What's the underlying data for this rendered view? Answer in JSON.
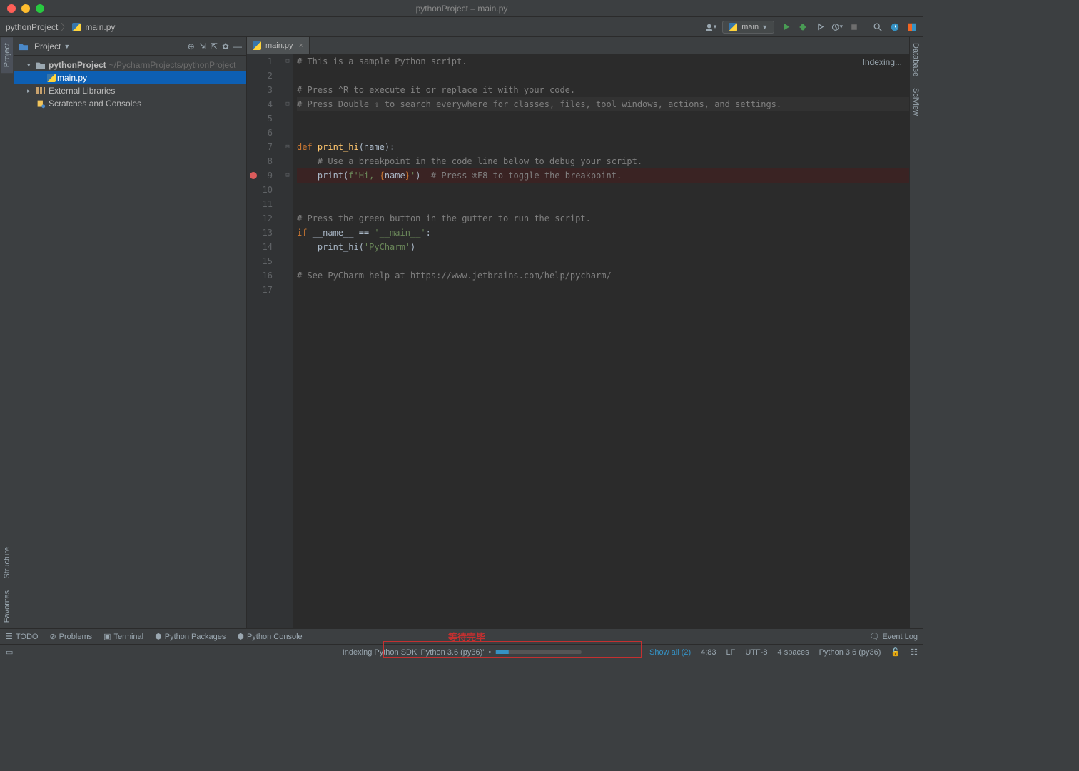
{
  "window": {
    "title": "pythonProject – main.py"
  },
  "breadcrumb": {
    "project": "pythonProject",
    "file": "main.py"
  },
  "toolbar": {
    "run_config": "main"
  },
  "project_panel": {
    "title": "Project",
    "root": {
      "name": "pythonProject",
      "path": "~/PycharmProjects/pythonProject"
    },
    "file": "main.py",
    "external": "External Libraries",
    "scratches": "Scratches and Consoles"
  },
  "editor": {
    "tab_label": "main.py",
    "indexing_text": "Indexing...",
    "code": {
      "l1": "# This is a sample Python script.",
      "l3": "# Press ^R to execute it or replace it with your code.",
      "l4": "# Press Double ⇧ to search everywhere for classes, files, tool windows, actions, and settings.",
      "l7_def": "def ",
      "l7_fn": "print_hi",
      "l7_rest": "(name):",
      "l8": "    # Use a breakpoint in the code line below to debug your script.",
      "l9_pre": "    print(",
      "l9_f": "f'Hi, ",
      "l9_brace_open": "{",
      "l9_name": "name",
      "l9_brace_close": "}",
      "l9_tail": "'",
      "l9_paren": ")",
      "l9_cmt": "  # Press ⌘F8 to toggle the breakpoint.",
      "l12": "# Press the green button in the gutter to run the script.",
      "l13_if": "if ",
      "l13_name": "__name__ == ",
      "l13_str": "'__main__'",
      "l13_colon": ":",
      "l14_pre": "    print_hi(",
      "l14_str": "'PyCharm'",
      "l14_close": ")",
      "l16": "# See PyCharm help at https://www.jetbrains.com/help/pycharm/"
    },
    "line_numbers": [
      "1",
      "2",
      "3",
      "4",
      "5",
      "6",
      "7",
      "8",
      "9",
      "10",
      "11",
      "12",
      "13",
      "14",
      "15",
      "16",
      "17"
    ]
  },
  "left_strip": {
    "project": "Project",
    "structure": "Structure",
    "favorites": "Favorites"
  },
  "right_strip": {
    "database": "Database",
    "sciview": "SciView"
  },
  "bottom_tools": {
    "todo": "TODO",
    "problems": "Problems",
    "terminal": "Terminal",
    "packages": "Python Packages",
    "console": "Python Console",
    "event_log": "Event Log"
  },
  "statusbar": {
    "indexing": "Indexing Python SDK 'Python 3.6 (py36)'",
    "show_all": "Show all (2)",
    "pos": "4:83",
    "lf": "LF",
    "encoding": "UTF-8",
    "indent": "4 spaces",
    "interpreter": "Python 3.6 (py36)"
  },
  "annotation": {
    "text": "等待完毕"
  }
}
